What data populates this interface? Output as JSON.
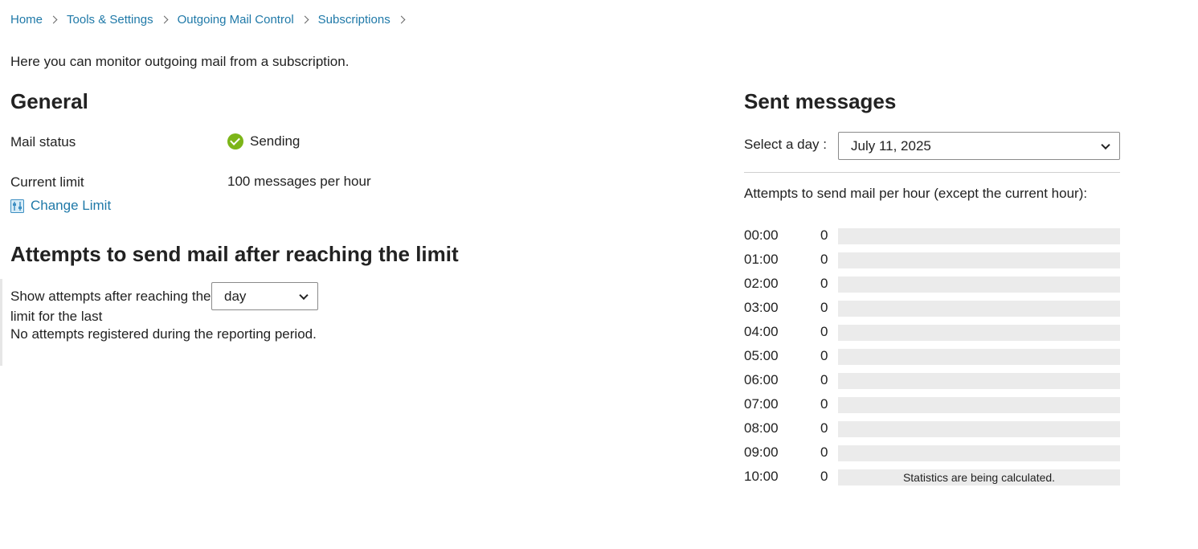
{
  "breadcrumb": [
    "Home",
    "Tools & Settings",
    "Outgoing Mail Control",
    "Subscriptions"
  ],
  "intro": "Here you can monitor outgoing mail from a subscription.",
  "general": {
    "title": "General",
    "mail_status_label": "Mail status",
    "mail_status_value": "Sending",
    "current_limit_label": "Current limit",
    "current_limit_value": "100 messages per hour",
    "change_limit": "Change Limit"
  },
  "attempts": {
    "title": "Attempts to send mail after reaching the limit",
    "show_label": "Show attempts after reaching the limit for the last",
    "period": "day",
    "empty": "No attempts registered during the reporting period."
  },
  "sent": {
    "title": "Sent messages",
    "select_day_label": "Select a day :",
    "selected_day": "July 11, 2025",
    "per_hour_label": "Attempts to send mail per hour (except the current hour):",
    "max_per_hour": 100,
    "hours": [
      {
        "time": "00:00",
        "count": "0",
        "value": 0,
        "note": ""
      },
      {
        "time": "01:00",
        "count": "0",
        "value": 0,
        "note": ""
      },
      {
        "time": "02:00",
        "count": "0",
        "value": 0,
        "note": ""
      },
      {
        "time": "03:00",
        "count": "0",
        "value": 0,
        "note": ""
      },
      {
        "time": "04:00",
        "count": "0",
        "value": 0,
        "note": ""
      },
      {
        "time": "05:00",
        "count": "0",
        "value": 0,
        "note": ""
      },
      {
        "time": "06:00",
        "count": "0",
        "value": 0,
        "note": ""
      },
      {
        "time": "07:00",
        "count": "0",
        "value": 0,
        "note": ""
      },
      {
        "time": "08:00",
        "count": "0",
        "value": 0,
        "note": ""
      },
      {
        "time": "09:00",
        "count": "0",
        "value": 0,
        "note": ""
      },
      {
        "time": "10:00",
        "count": "0",
        "value": 0,
        "note": "Statistics are being calculated."
      }
    ]
  },
  "colors": {
    "link": "#1f79a8",
    "success": "#7cb518",
    "bar_track": "#ebebeb"
  },
  "icons": {
    "status": "check-circle-icon",
    "change_limit": "sliders-icon",
    "separator": "chevron-right-icon",
    "select": "chevron-down-icon"
  }
}
